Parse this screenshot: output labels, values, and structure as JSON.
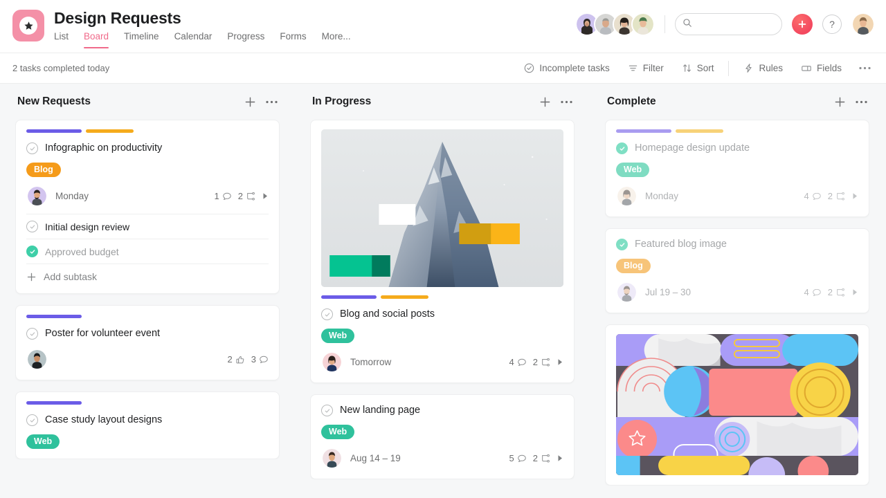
{
  "header": {
    "project_title": "Design Requests",
    "logo_icon": "star-icon",
    "tabs": [
      {
        "label": "List",
        "active": false
      },
      {
        "label": "Board",
        "active": true
      },
      {
        "label": "Timeline",
        "active": false
      },
      {
        "label": "Calendar",
        "active": false
      },
      {
        "label": "Progress",
        "active": false
      },
      {
        "label": "Forms",
        "active": false
      },
      {
        "label": "More...",
        "active": false
      }
    ],
    "search": {
      "placeholder": "",
      "value": "",
      "icon": "search-icon"
    },
    "add_button_icon": "plus-icon",
    "help_button_label": "?",
    "member_avatars": 4
  },
  "subbar": {
    "tasks_completed": "2 tasks completed today",
    "tools": [
      {
        "label": "Incomplete tasks",
        "icon": "check-circle-icon"
      },
      {
        "label": "Filter",
        "icon": "filter-icon"
      },
      {
        "label": "Sort",
        "icon": "sort-arrows-icon"
      },
      {
        "label": "Rules",
        "icon": "lightning-bolt-icon"
      },
      {
        "label": "Fields",
        "icon": "fields-icon"
      }
    ],
    "overflow_icon": "ellipsis-icon"
  },
  "colors": {
    "project_purple": "#6b5ce7",
    "project_yellow": "#f5ab1c",
    "pill_blog": "#f59b1a",
    "pill_web": "#2fc19c",
    "accent_pink": "#f06a8a",
    "done_green": "#3ecfa8",
    "board_bg": "#f6f7f8"
  },
  "columns": [
    {
      "title": "New Requests",
      "add_icon": "plus-icon",
      "menu_icon": "ellipsis-icon",
      "cards": [
        {
          "id": "infographic",
          "project_bars": [
            "#6b5ce7",
            "#f5ab1c"
          ],
          "title": "Infographic on productivity",
          "completed": false,
          "pill": {
            "label": "Blog",
            "color": "#f59b1a"
          },
          "assignee_date": "Monday",
          "stats": [
            {
              "value": "1",
              "icon": "comment-icon"
            },
            {
              "value": "2",
              "icon": "subtask-icon"
            }
          ],
          "caret": true,
          "subtasks": [
            {
              "label": "Initial design review",
              "done": false
            },
            {
              "label": "Approved budget",
              "done": true
            }
          ],
          "add_subtask_label": "Add subtask"
        },
        {
          "id": "poster",
          "project_bars": [
            "#6b5ce7"
          ],
          "title": "Poster for volunteer event",
          "completed": false,
          "assignee_date": "",
          "stats": [
            {
              "value": "2",
              "icon": "thumbs-up-icon"
            },
            {
              "value": "3",
              "icon": "comment-icon"
            }
          ],
          "caret": false
        },
        {
          "id": "casestudy",
          "project_bars": [
            "#6b5ce7"
          ],
          "title": "Case study layout designs",
          "completed": false,
          "pill": {
            "label": "Web",
            "color": "#2fc19c"
          }
        }
      ]
    },
    {
      "title": "In Progress",
      "add_icon": "plus-icon",
      "menu_icon": "ellipsis-icon",
      "cards": [
        {
          "id": "blogsocial",
          "cover": "mountain-photo",
          "project_bars": [
            "#6b5ce7",
            "#f5ab1c"
          ],
          "title": "Blog and social posts",
          "completed": false,
          "pill": {
            "label": "Web",
            "color": "#2fc19c"
          },
          "assignee_date": "Tomorrow",
          "stats": [
            {
              "value": "4",
              "icon": "comment-icon"
            },
            {
              "value": "2",
              "icon": "subtask-icon"
            }
          ],
          "caret": true
        },
        {
          "id": "landingpage",
          "title": "New landing page",
          "completed": false,
          "pill": {
            "label": "Web",
            "color": "#2fc19c"
          },
          "assignee_date": "Aug 14 – 19",
          "stats": [
            {
              "value": "5",
              "icon": "comment-icon"
            },
            {
              "value": "2",
              "icon": "subtask-icon"
            }
          ],
          "caret": true
        }
      ]
    },
    {
      "title": "Complete",
      "add_icon": "plus-icon",
      "menu_icon": "ellipsis-icon",
      "cards": [
        {
          "id": "homepage",
          "project_bars": [
            "#a99cf0",
            "#f7d279"
          ],
          "title": "Homepage design update",
          "completed": true,
          "faded": true,
          "pill": {
            "label": "Web",
            "color": "#7fdcc2"
          },
          "assignee_date": "Monday",
          "stats": [
            {
              "value": "4",
              "icon": "comment-icon"
            },
            {
              "value": "2",
              "icon": "subtask-icon"
            }
          ],
          "caret": true
        },
        {
          "id": "featuredblog",
          "title": "Featured blog image",
          "completed": true,
          "faded": true,
          "pill": {
            "label": "Blog",
            "color": "#f7c479"
          },
          "assignee_date": "Jul 19 – 30",
          "stats": [
            {
              "value": "4",
              "icon": "comment-icon"
            },
            {
              "value": "2",
              "icon": "subtask-icon"
            }
          ],
          "caret": true
        },
        {
          "id": "abstractcover",
          "cover": "abstract-graphic"
        }
      ]
    }
  ]
}
